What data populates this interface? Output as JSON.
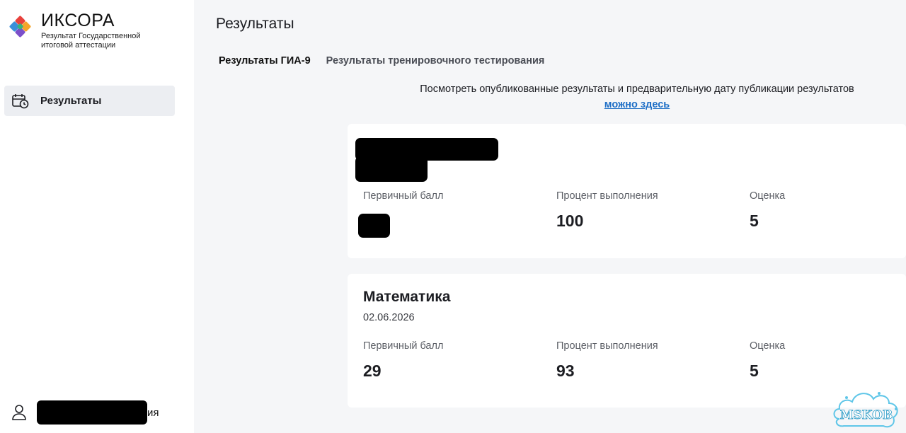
{
  "app": {
    "title": "ИКСОРА",
    "subtitle_line1": "Результат Государственной",
    "subtitle_line2": "итоговой аттестации"
  },
  "sidebar": {
    "items": [
      {
        "label": "Результаты",
        "icon": "calendar-clock-icon",
        "active": true
      }
    ],
    "user": {
      "name_tail": "ия",
      "icon": "user-icon"
    }
  },
  "main": {
    "title": "Результаты",
    "tabs": [
      {
        "label": "Результаты ГИА-9",
        "active": true
      },
      {
        "label": "Результаты тренировочного тестирования",
        "active": false
      }
    ],
    "notice": {
      "text": "Посмотреть опубликованные результаты и предварительную дату публикации результатов",
      "link": "можно здесь"
    }
  },
  "results": [
    {
      "subject": "",
      "date": "",
      "primary_label": "Первичный балл",
      "primary_value": "",
      "percent_label": "Процент выполнения",
      "percent_value": "100",
      "grade_label": "Оценка",
      "grade_value": "5"
    },
    {
      "subject": "Математика",
      "date": "02.06.2026",
      "primary_label": "Первичный балл",
      "primary_value": "29",
      "percent_label": "Процент выполнения",
      "percent_value": "93",
      "grade_label": "Оценка",
      "grade_value": "5"
    }
  ],
  "watermark": {
    "text": "MSKOB"
  },
  "colors": {
    "link": "#1f6fc6",
    "logo": [
      "#e8413c",
      "#f4a52b",
      "#3a8fd9",
      "#7b4fc9",
      "#36b37e"
    ]
  }
}
